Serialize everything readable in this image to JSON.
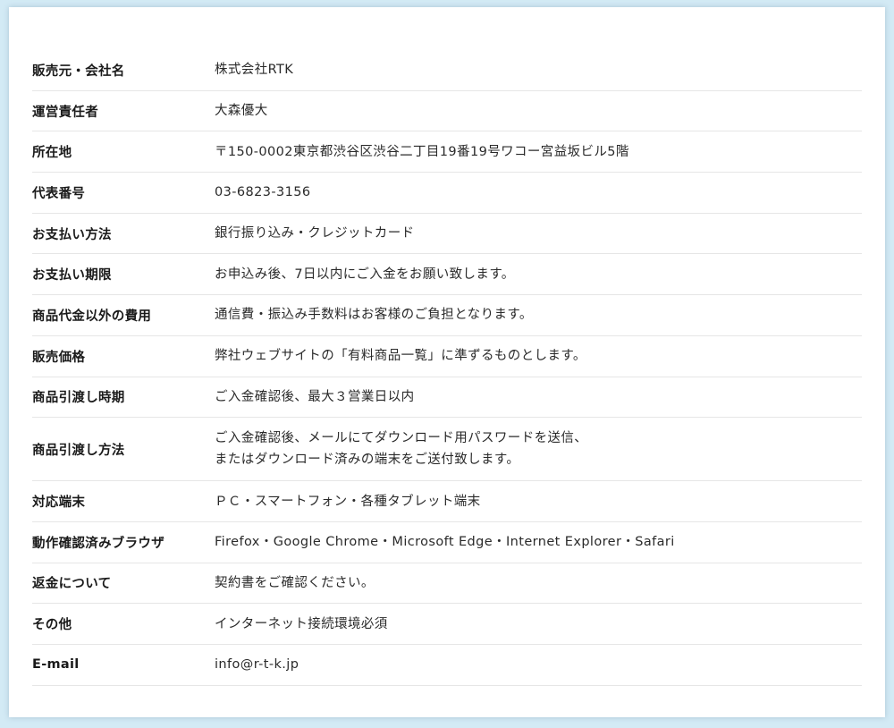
{
  "rows": [
    {
      "label": "販売元・会社名",
      "value": [
        "株式会社RTK"
      ]
    },
    {
      "label": "運営責任者",
      "value": [
        "大森優大"
      ]
    },
    {
      "label": "所在地",
      "value": [
        "〒150-0002東京都渋谷区渋谷二丁目19番19号ワコー宮益坂ビル5階"
      ]
    },
    {
      "label": "代表番号",
      "value": [
        "03-6823-3156"
      ]
    },
    {
      "label": "お支払い方法",
      "value": [
        "銀行振り込み・クレジットカード"
      ]
    },
    {
      "label": "お支払い期限",
      "value": [
        "お申込み後、7日以内にご入金をお願い致します。"
      ]
    },
    {
      "label": "商品代金以外の費用",
      "value": [
        "通信費・振込み手数料はお客様のご負担となります。"
      ]
    },
    {
      "label": "販売価格",
      "value": [
        "弊社ウェブサイトの「有料商品一覧」に準ずるものとします。"
      ]
    },
    {
      "label": "商品引渡し時期",
      "value": [
        "ご入金確認後、最大３営業日以内"
      ]
    },
    {
      "label": "商品引渡し方法",
      "value": [
        "ご入金確認後、メールにてダウンロード用パスワードを送信、",
        "またはダウンロード済みの端末をご送付致します。"
      ]
    },
    {
      "label": "対応端末",
      "value": [
        "ＰＣ・スマートフォン・各種タブレット端末"
      ]
    },
    {
      "label": "動作確認済みブラウザ",
      "value": [
        "Firefox・Google Chrome・Microsoft Edge・Internet Explorer・Safari"
      ]
    },
    {
      "label": "返金について",
      "value": [
        "契約書をご確認ください。"
      ]
    },
    {
      "label": "その他",
      "value": [
        "インターネット接続環境必須"
      ]
    },
    {
      "label": "E-mail",
      "value": [
        "info@r-t-k.jp"
      ]
    }
  ]
}
